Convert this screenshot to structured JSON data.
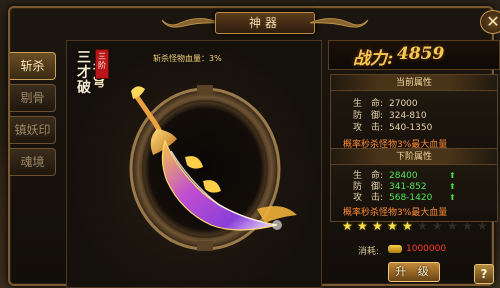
{
  "window": {
    "title": "神器",
    "close_glyph": "✕"
  },
  "side_tabs": [
    {
      "label": "斩杀",
      "active": true
    },
    {
      "label": "剔骨",
      "active": false
    },
    {
      "label": "镇妖印",
      "active": false
    },
    {
      "label": "魂境",
      "active": false
    }
  ],
  "weapon": {
    "name": "三才破苍穹",
    "name_col1": "三才破",
    "name_col2": "苍穹",
    "seal_text": "三阶",
    "kill_text": "斩杀怪物血量：3%"
  },
  "power": {
    "label": "战力:",
    "value": "4859"
  },
  "current_attrs": {
    "header": "当前属性",
    "rows": [
      {
        "label": "生　命:",
        "value": "27000"
      },
      {
        "label": "防　御:",
        "value": "324-810"
      },
      {
        "label": "攻　击:",
        "value": "540-1350"
      }
    ],
    "note": "概率秒杀怪物3%最大血量"
  },
  "next_attrs": {
    "header": "下阶属性",
    "rows": [
      {
        "label": "生　命:",
        "value": "28400"
      },
      {
        "label": "防　御:",
        "value": "341-852"
      },
      {
        "label": "攻　击:",
        "value": "568-1420"
      }
    ],
    "note": "概率秒杀怪物3%最大血量"
  },
  "stars": {
    "filled": 5,
    "total": 10
  },
  "cost": {
    "label": "消耗:",
    "value": "1000000",
    "icon": "gold-ingot-icon"
  },
  "upgrade_button": "升 级",
  "help_button": "?",
  "colors": {
    "gold": "#f6c955",
    "green": "#50e35a",
    "orange": "#ff8a34",
    "red": "#ff3a2a"
  }
}
